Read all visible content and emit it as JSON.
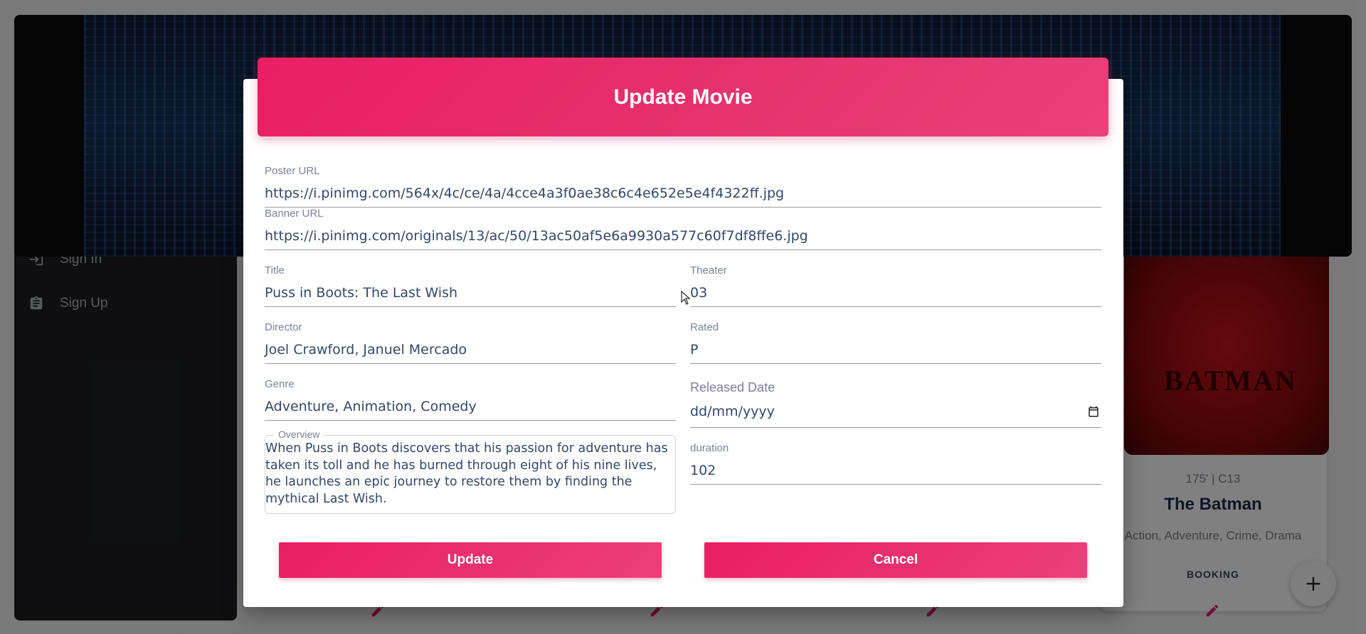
{
  "sidebar": {
    "items": [
      {
        "label": "Sign In",
        "icon": "login-icon"
      },
      {
        "label": "Sign Up",
        "icon": "clipboard-icon"
      }
    ]
  },
  "movie_card": {
    "meta": "175' | C13",
    "title": "The Batman",
    "genres": "Action, Adventure, Crime, Drama",
    "booking_label": "BOOKING",
    "poster_logo": "BATMAN"
  },
  "fab": {
    "label": "+"
  },
  "dialog": {
    "title": "Update Movie",
    "fields": {
      "poster_url": {
        "label": "Poster URL",
        "value": "https://i.pinimg.com/564x/4c/ce/4a/4cce4a3f0ae38c6c4e652e5e4f4322ff.jpg"
      },
      "banner_url": {
        "label": "Banner URL",
        "value": "https://i.pinimg.com/originals/13/ac/50/13ac50af5e6a9930a577c60f7df8ffe6.jpg"
      },
      "title": {
        "label": "Title",
        "value": "Puss in Boots: The Last Wish"
      },
      "theater": {
        "label": "Theater",
        "value": "03"
      },
      "director": {
        "label": "Director",
        "value": "Joel Crawford, Januel Mercado"
      },
      "rated": {
        "label": "Rated",
        "value": "P"
      },
      "genre": {
        "label": "Genre",
        "value": "Adventure, Animation, Comedy"
      },
      "released_date": {
        "label": "Released Date",
        "placeholder": "dd/mm/yyyy"
      },
      "overview": {
        "label": "Overview",
        "value": "When Puss in Boots discovers that his passion for adventure has taken its toll and he has burned through eight of his nine lives, he launches an epic journey to restore them by finding the mythical Last Wish."
      },
      "duration": {
        "label": "duration",
        "value": "102"
      }
    },
    "buttons": {
      "update": "Update",
      "cancel": "Cancel"
    }
  },
  "colors": {
    "accent": "#e91e63",
    "sidebar_bg": "#1d1e22",
    "text": "#344767",
    "label": "#7b809a"
  }
}
